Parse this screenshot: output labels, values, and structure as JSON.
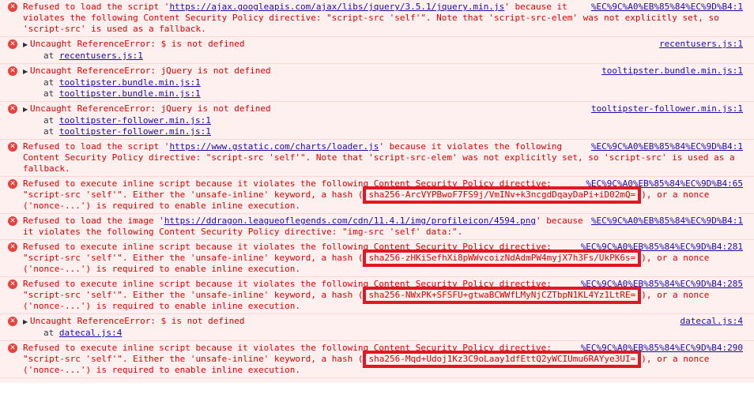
{
  "messages": [
    {
      "type": "csp",
      "source": "%EC%9C%A0%EB%85%84%EC%9D%B4:1",
      "prefix": "Refused to load the script '",
      "url": "https://ajax.googleapis.com/ajax/libs/jquery/3.5.1/jquery.min.js",
      "line1_suffix": "' because it",
      "line2": "violates the following Content Security Policy directive: \"script-src 'self'\". Note that 'script-src-elem' was not explicitly set, so",
      "line3": "'script-src' is used as a fallback."
    },
    {
      "type": "ref",
      "source": "recentusers.js:1",
      "text": "Uncaught ReferenceError: $ is not defined",
      "stack": [
        {
          "at": "at ",
          "file": "recentusers.js:1"
        }
      ]
    },
    {
      "type": "ref",
      "source": "tooltipster.bundle.min.js:1",
      "text": "Uncaught ReferenceError: jQuery is not defined",
      "stack": [
        {
          "at": "at ",
          "file": "tooltipster.bundle.min.js:1"
        },
        {
          "at": "at ",
          "file": "tooltipster.bundle.min.js:1"
        }
      ]
    },
    {
      "type": "ref",
      "source": "tooltipster-follower.min.js:1",
      "text": "Uncaught ReferenceError: jQuery is not defined",
      "stack": [
        {
          "at": "at ",
          "file": "tooltipster-follower.min.js:1"
        },
        {
          "at": "at ",
          "file": "tooltipster-follower.min.js:1"
        }
      ]
    },
    {
      "type": "csp",
      "source": "%EC%9C%A0%EB%85%84%EC%9D%B4:1",
      "prefix": "Refused to load the script '",
      "url": "https://www.gstatic.com/charts/loader.js",
      "line1_suffix": "' because it violates the following",
      "line2": "Content Security Policy directive: \"script-src 'self'\". Note that 'script-src-elem' was not explicitly set, so 'script-src' is used as a",
      "line3": "fallback."
    },
    {
      "type": "inline",
      "source": "%EC%9C%A0%EB%85%84%EC%9D%B4:65",
      "line1": "Refused to execute inline script because it violates the following Content Security Policy directive:",
      "line2_prefix": "\"script-src 'self'\". Either the 'unsafe-inline' keyword, a hash (",
      "hash": "sha256-ArcVYPBwoF7FS9j/VmINv+k3ncgdDqayDaPi+iD02mQ=",
      "line2_suffix": "), or a nonce",
      "line3": "('nonce-...') is required to enable inline execution."
    },
    {
      "type": "csp",
      "source": "%EC%9C%A0%EB%85%84%EC%9D%B4:1",
      "prefix": "Refused to load the image '",
      "url": "https://ddragon.leagueoflegends.com/cdn/11.4.1/img/profileicon/4594.png",
      "line1_suffix": "' because",
      "line2": "it violates the following Content Security Policy directive: \"img-src 'self' data:\".",
      "line3": ""
    },
    {
      "type": "inline",
      "source": "%EC%9C%A0%EB%85%84%EC%9D%B4:281",
      "line1": "Refused to execute inline script because it violates the following Content Security Policy directive:",
      "line2_prefix": "\"script-src 'self'\". Either the 'unsafe-inline' keyword, a hash (",
      "hash": "sha256-zHKiSefhXi8pWWvcoizNdAdmPW4myjX7h3Fs/UkPK6s=",
      "line2_suffix": "), or a nonce",
      "line3": "('nonce-...') is required to enable inline execution."
    },
    {
      "type": "inline",
      "source": "%EC%9C%A0%EB%85%84%EC%9D%B4:285",
      "line1": "Refused to execute inline script because it violates the following Content Security Policy directive:",
      "line2_prefix": "\"script-src 'self'\". Either the 'unsafe-inline' keyword, a hash (",
      "hash": "sha256-NWxPK+SFSFU+gtwaBCWWfLMyNjCZTbpN1KL4Yz1LtRE=",
      "line2_suffix": "), or a nonce",
      "line3": "('nonce-...') is required to enable inline execution."
    },
    {
      "type": "ref",
      "source": "datecal.js:4",
      "text": "Uncaught ReferenceError: $ is not defined",
      "stack": [
        {
          "at": "at ",
          "file": "datecal.js:4"
        }
      ]
    },
    {
      "type": "inline",
      "source": "%EC%9C%A0%EB%85%84%EC%9D%B4:290",
      "line1": "Refused to execute inline script because it violates the following Content Security Policy directive:",
      "line2_prefix": "\"script-src 'self'\". Either the 'unsafe-inline' keyword, a hash (",
      "hash": "sha256-Mqd+Udoj1Kz3C9oLaay1dfEttQ2yWCIUmu6RAYye3UI=",
      "line2_suffix": "), or a nonce",
      "line3": "('nonce-...') is required to enable inline execution."
    }
  ],
  "colors": {
    "error_text": "#e00000",
    "error_bg": "#fff0f0",
    "link": "#1a0dab",
    "highlight": "#e11722"
  },
  "icons": {
    "error": "error-circle-icon",
    "expand": "triangle-right-icon"
  }
}
